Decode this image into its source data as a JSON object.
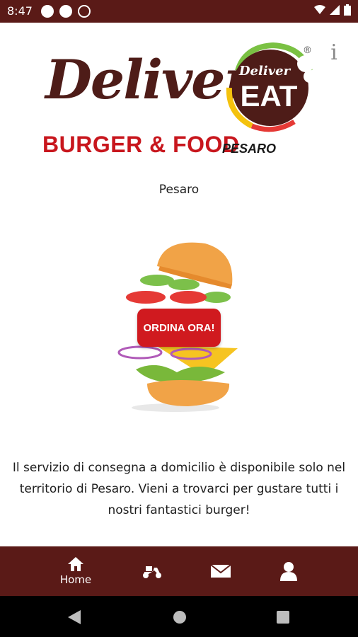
{
  "status_bar": {
    "time": "8:47"
  },
  "logo": {
    "wordmark": "Deliver",
    "tagline": "BURGER & FOOD",
    "location": "PESARO",
    "badge_top": "Deliver",
    "badge_main": "EAT",
    "registered": "®"
  },
  "header": {
    "info_icon": "i"
  },
  "main": {
    "city": "Pesaro",
    "order_button": "ORDINA ORA!",
    "description": "Il servizio di consegna a domicilio è disponibile solo nel territorio di Pesaro. Vieni a trovarci per gustare tutti i nostri fantastici burger!"
  },
  "bottom_nav": {
    "home_label": "Home"
  },
  "colors": {
    "brand_dark": "#5a1a17",
    "accent_red": "#d01a1f"
  }
}
